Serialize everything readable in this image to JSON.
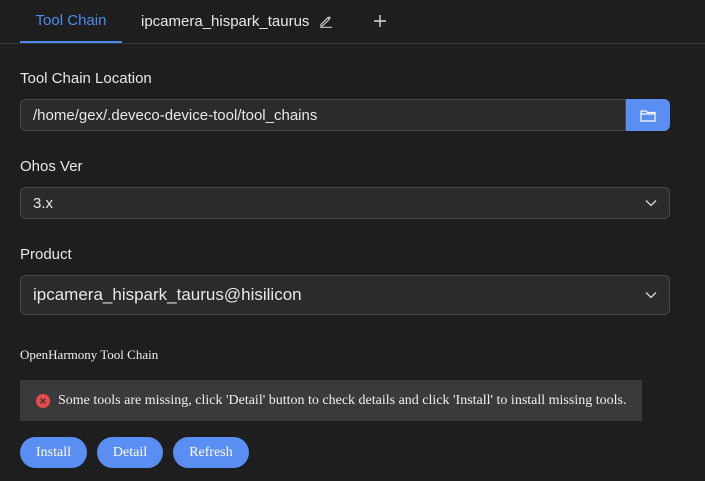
{
  "tabs": [
    {
      "label": "Tool Chain"
    },
    {
      "label": "ipcamera_hispark_taurus"
    }
  ],
  "toolchain_location": {
    "label": "Tool Chain Location",
    "value": "/home/gex/.deveco-device-tool/tool_chains"
  },
  "ohos_ver": {
    "label": "Ohos Ver",
    "value": "3.x"
  },
  "product": {
    "label": "Product",
    "value": "ipcamera_hispark_taurus@hisilicon"
  },
  "section": {
    "title": "OpenHarmony Tool Chain"
  },
  "alert": {
    "message": "Some tools are missing, click 'Detail' button to check details and click 'Install' to install missing tools."
  },
  "buttons": {
    "install": "Install",
    "detail": "Detail",
    "refresh": "Refresh"
  },
  "colors": {
    "accent": "#5a8ef3",
    "active_tab": "#4a8cf0",
    "error": "#e84a4a",
    "background": "#1e1e1f"
  }
}
